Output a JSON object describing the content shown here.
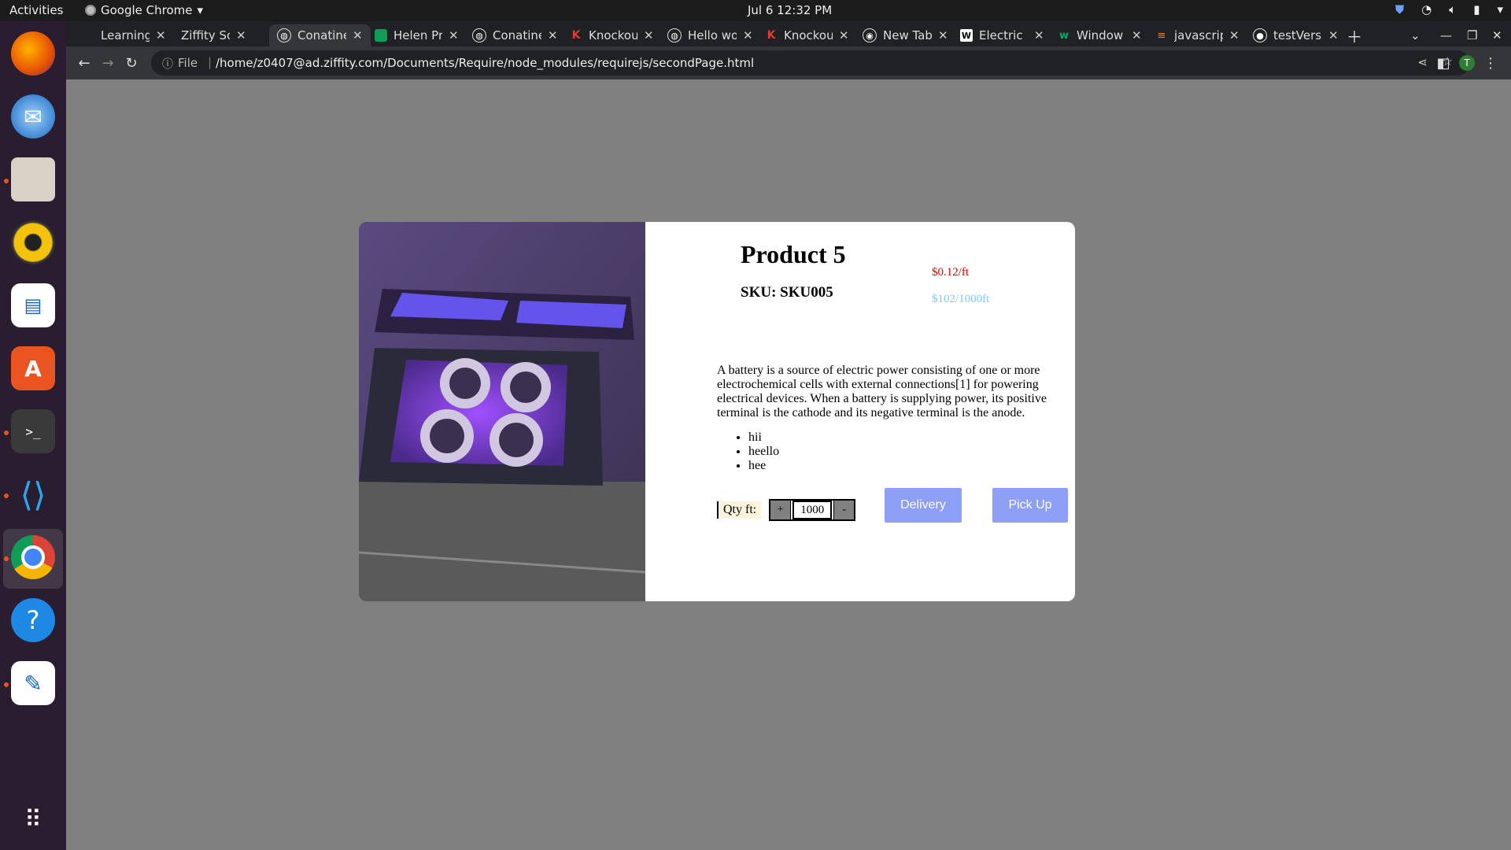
{
  "topbar": {
    "activities": "Activities",
    "app_name": "Google Chrome",
    "clock": "Jul 6  12:32 PM"
  },
  "tabs": [
    {
      "title": "Learning",
      "icon": "doc-icon",
      "active": false
    },
    {
      "title": "Ziffity So",
      "icon": "blank-icon",
      "active": false
    },
    {
      "title": "Conatine",
      "icon": "globe-icon",
      "active": true
    },
    {
      "title": "Helen Pr",
      "icon": "chat-icon",
      "active": false
    },
    {
      "title": "Conatine",
      "icon": "globe-icon",
      "active": false
    },
    {
      "title": "Knockou",
      "icon": "knockout-icon",
      "active": false
    },
    {
      "title": "Hello wo",
      "icon": "globe-icon",
      "active": false
    },
    {
      "title": "Knockou",
      "icon": "knockout-icon",
      "active": false
    },
    {
      "title": "New Tab",
      "icon": "chrome-icon",
      "active": false
    },
    {
      "title": "Electric",
      "icon": "wikipedia-icon",
      "active": false
    },
    {
      "title": "Window",
      "icon": "w3-icon",
      "active": false
    },
    {
      "title": "javascrip",
      "icon": "stackoverflow-icon",
      "active": false
    },
    {
      "title": "testVers",
      "icon": "github-icon",
      "active": false
    }
  ],
  "toolbar": {
    "file_label": "File",
    "url": "/home/z0407@ad.ziffity.com/Documents/Require/node_modules/requirejs/secondPage.html",
    "profile_initial": "T"
  },
  "product": {
    "title": "Product 5",
    "sku": "SKU: SKU005",
    "price_per_ft": "$0.12/ft",
    "price_per_1000": "$102/1000ft",
    "description": "A battery is a source of electric power consisting of one or more electrochemical cells with external connections[1] for powering electrical devices. When a battery is supplying power, its positive terminal is the cathode and its negative terminal is the anode.",
    "bullets": [
      "hii",
      "heello",
      "hee"
    ],
    "qty_label": "Qty ft:",
    "qty_value": "1000",
    "plus_label": "+",
    "minus_label": "-",
    "delivery_label": "Delivery",
    "pickup_label": "Pick Up"
  },
  "colors": {
    "price_red": "#e00000",
    "price_blue": "#80c8ff",
    "button_bg": "#8ea0f5",
    "backdrop": "#808080"
  }
}
